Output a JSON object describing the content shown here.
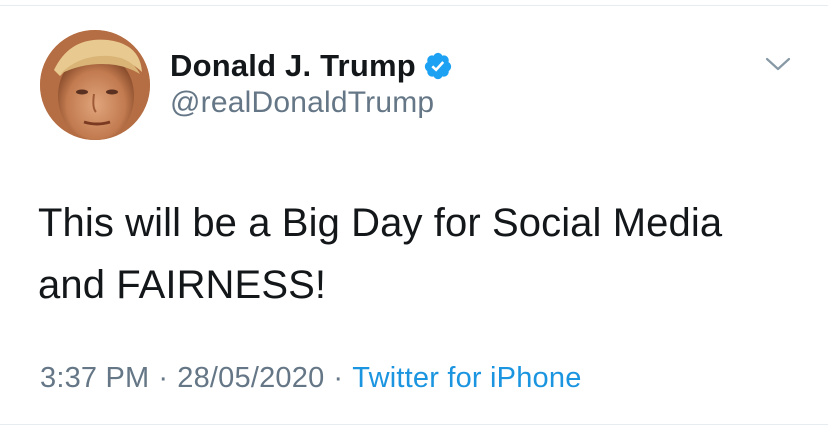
{
  "tweet": {
    "author": {
      "display_name": "Donald J. Trump",
      "handle": "@realDonaldTrump",
      "verified_icon": "verified-badge-icon",
      "avatar_icon": "profile-photo"
    },
    "menu_icon": "chevron-down-icon",
    "text_lines": [
      "This will be a Big Day for Social Media",
      "and FAIRNESS!"
    ],
    "time": "3:37 PM",
    "separator": "·",
    "date": "28/05/2020",
    "source": "Twitter for iPhone"
  },
  "colors": {
    "text_primary": "#14171a",
    "text_secondary": "#657786",
    "link": "#1b95e0",
    "verified": "#1da1f2",
    "divider": "#e6ecf0"
  }
}
